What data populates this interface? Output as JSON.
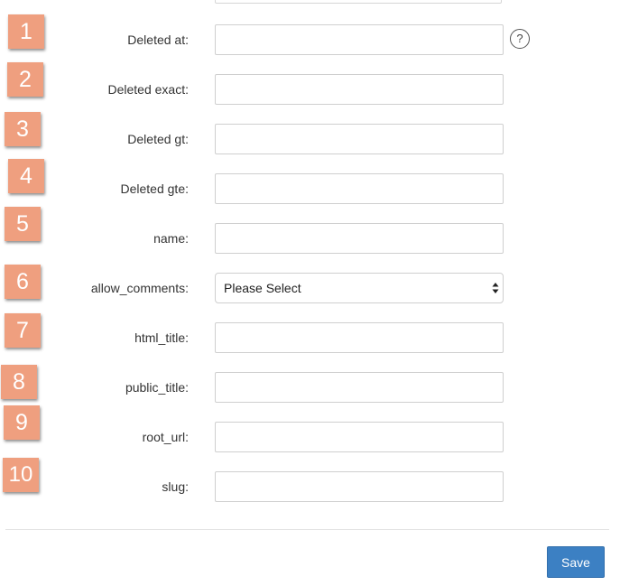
{
  "form": {
    "fields": [
      {
        "label": "Deleted at:",
        "value": ""
      },
      {
        "label": "Deleted exact:",
        "value": ""
      },
      {
        "label": "Deleted gt:",
        "value": ""
      },
      {
        "label": "Deleted gte:",
        "value": ""
      },
      {
        "label": "name:",
        "value": ""
      },
      {
        "label": "allow_comments:",
        "selected": "Please Select"
      },
      {
        "label": "html_title:",
        "value": ""
      },
      {
        "label": "public_title:",
        "value": ""
      },
      {
        "label": "root_url:",
        "value": ""
      },
      {
        "label": "slug:",
        "value": ""
      }
    ],
    "help_glyph": "?",
    "save_label": "Save"
  },
  "badges": [
    "1",
    "2",
    "3",
    "4",
    "5",
    "6",
    "7",
    "8",
    "9",
    "10"
  ],
  "colors": {
    "badge": "#ef9f7f",
    "save_button": "#3c80c3",
    "input_border": "#cfcfcf"
  },
  "icons": {
    "help": "question-circle-icon",
    "select_arrows": "sort-arrows-icon"
  }
}
